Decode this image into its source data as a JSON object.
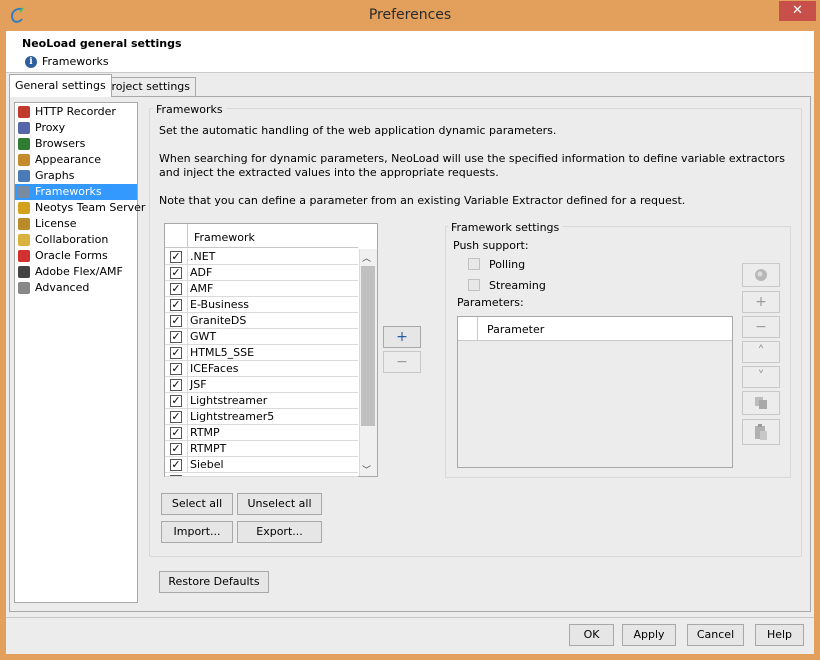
{
  "window": {
    "title": "Preferences"
  },
  "header": {
    "title": "NeoLoad general settings",
    "subtitle": "Frameworks"
  },
  "tabs": [
    {
      "label": "General settings"
    },
    {
      "label": "Project settings"
    }
  ],
  "nav": [
    {
      "label": "HTTP Recorder",
      "icon": "recorder-icon",
      "color": "#c0392b"
    },
    {
      "label": "Proxy",
      "icon": "proxy-icon",
      "color": "#5566aa"
    },
    {
      "label": "Browsers",
      "icon": "globe-icon",
      "color": "#2e7d32"
    },
    {
      "label": "Appearance",
      "icon": "palette-icon",
      "color": "#c68a2e"
    },
    {
      "label": "Graphs",
      "icon": "graph-icon",
      "color": "#4a7bb7"
    },
    {
      "label": "Frameworks",
      "icon": "gears-icon",
      "color": "#7a8aa0",
      "selected": true
    },
    {
      "label": "Neotys Team Server",
      "icon": "team-server-icon",
      "color": "#d4a11e"
    },
    {
      "label": "License",
      "icon": "license-icon",
      "color": "#b88a2a"
    },
    {
      "label": "Collaboration",
      "icon": "collaboration-icon",
      "color": "#d9b340"
    },
    {
      "label": "Oracle Forms",
      "icon": "oracle-icon",
      "color": "#d32f2f"
    },
    {
      "label": "Adobe Flex/AMF",
      "icon": "flex-icon",
      "color": "#444444"
    },
    {
      "label": "Advanced",
      "icon": "advanced-gear-icon",
      "color": "#888888"
    }
  ],
  "frameworks": {
    "group_title": "Frameworks",
    "desc1": "Set the automatic handling of the web application dynamic parameters.",
    "desc2": "When searching for dynamic parameters, NeoLoad will use the specified information to define variable extractors and inject the extracted values into the appropriate requests.",
    "desc3": "Note that you can define a parameter from an existing Variable Extractor defined for a request.",
    "column": "Framework",
    "rows": [
      {
        "name": ".NET",
        "checked": true
      },
      {
        "name": "ADF",
        "checked": true
      },
      {
        "name": "AMF",
        "checked": true
      },
      {
        "name": "E-Business",
        "checked": true
      },
      {
        "name": "GraniteDS",
        "checked": true
      },
      {
        "name": "GWT",
        "checked": true
      },
      {
        "name": "HTML5_SSE",
        "checked": true
      },
      {
        "name": "ICEFaces",
        "checked": true
      },
      {
        "name": "JSF",
        "checked": true
      },
      {
        "name": "Lightstreamer",
        "checked": true
      },
      {
        "name": "Lightstreamer5",
        "checked": true
      },
      {
        "name": "RTMP",
        "checked": true
      },
      {
        "name": "RTMPT",
        "checked": true
      },
      {
        "name": "Siebel",
        "checked": true
      }
    ],
    "add_label": "+",
    "remove_label": "−",
    "select_all": "Select all",
    "unselect_all": "Unselect all",
    "import": "Import...",
    "export": "Export..."
  },
  "framework_settings": {
    "title": "Framework settings",
    "push_support": "Push support:",
    "polling": "Polling",
    "streaming": "Streaming",
    "parameters_label": "Parameters:",
    "parameter_column": "Parameter",
    "side_buttons": [
      "search-icon",
      "+",
      "−",
      "˄",
      "˅",
      "copy-icon",
      "paste-icon"
    ]
  },
  "restore_defaults": "Restore Defaults",
  "footer": {
    "ok": "OK",
    "apply": "Apply",
    "cancel": "Cancel",
    "help": "Help"
  }
}
